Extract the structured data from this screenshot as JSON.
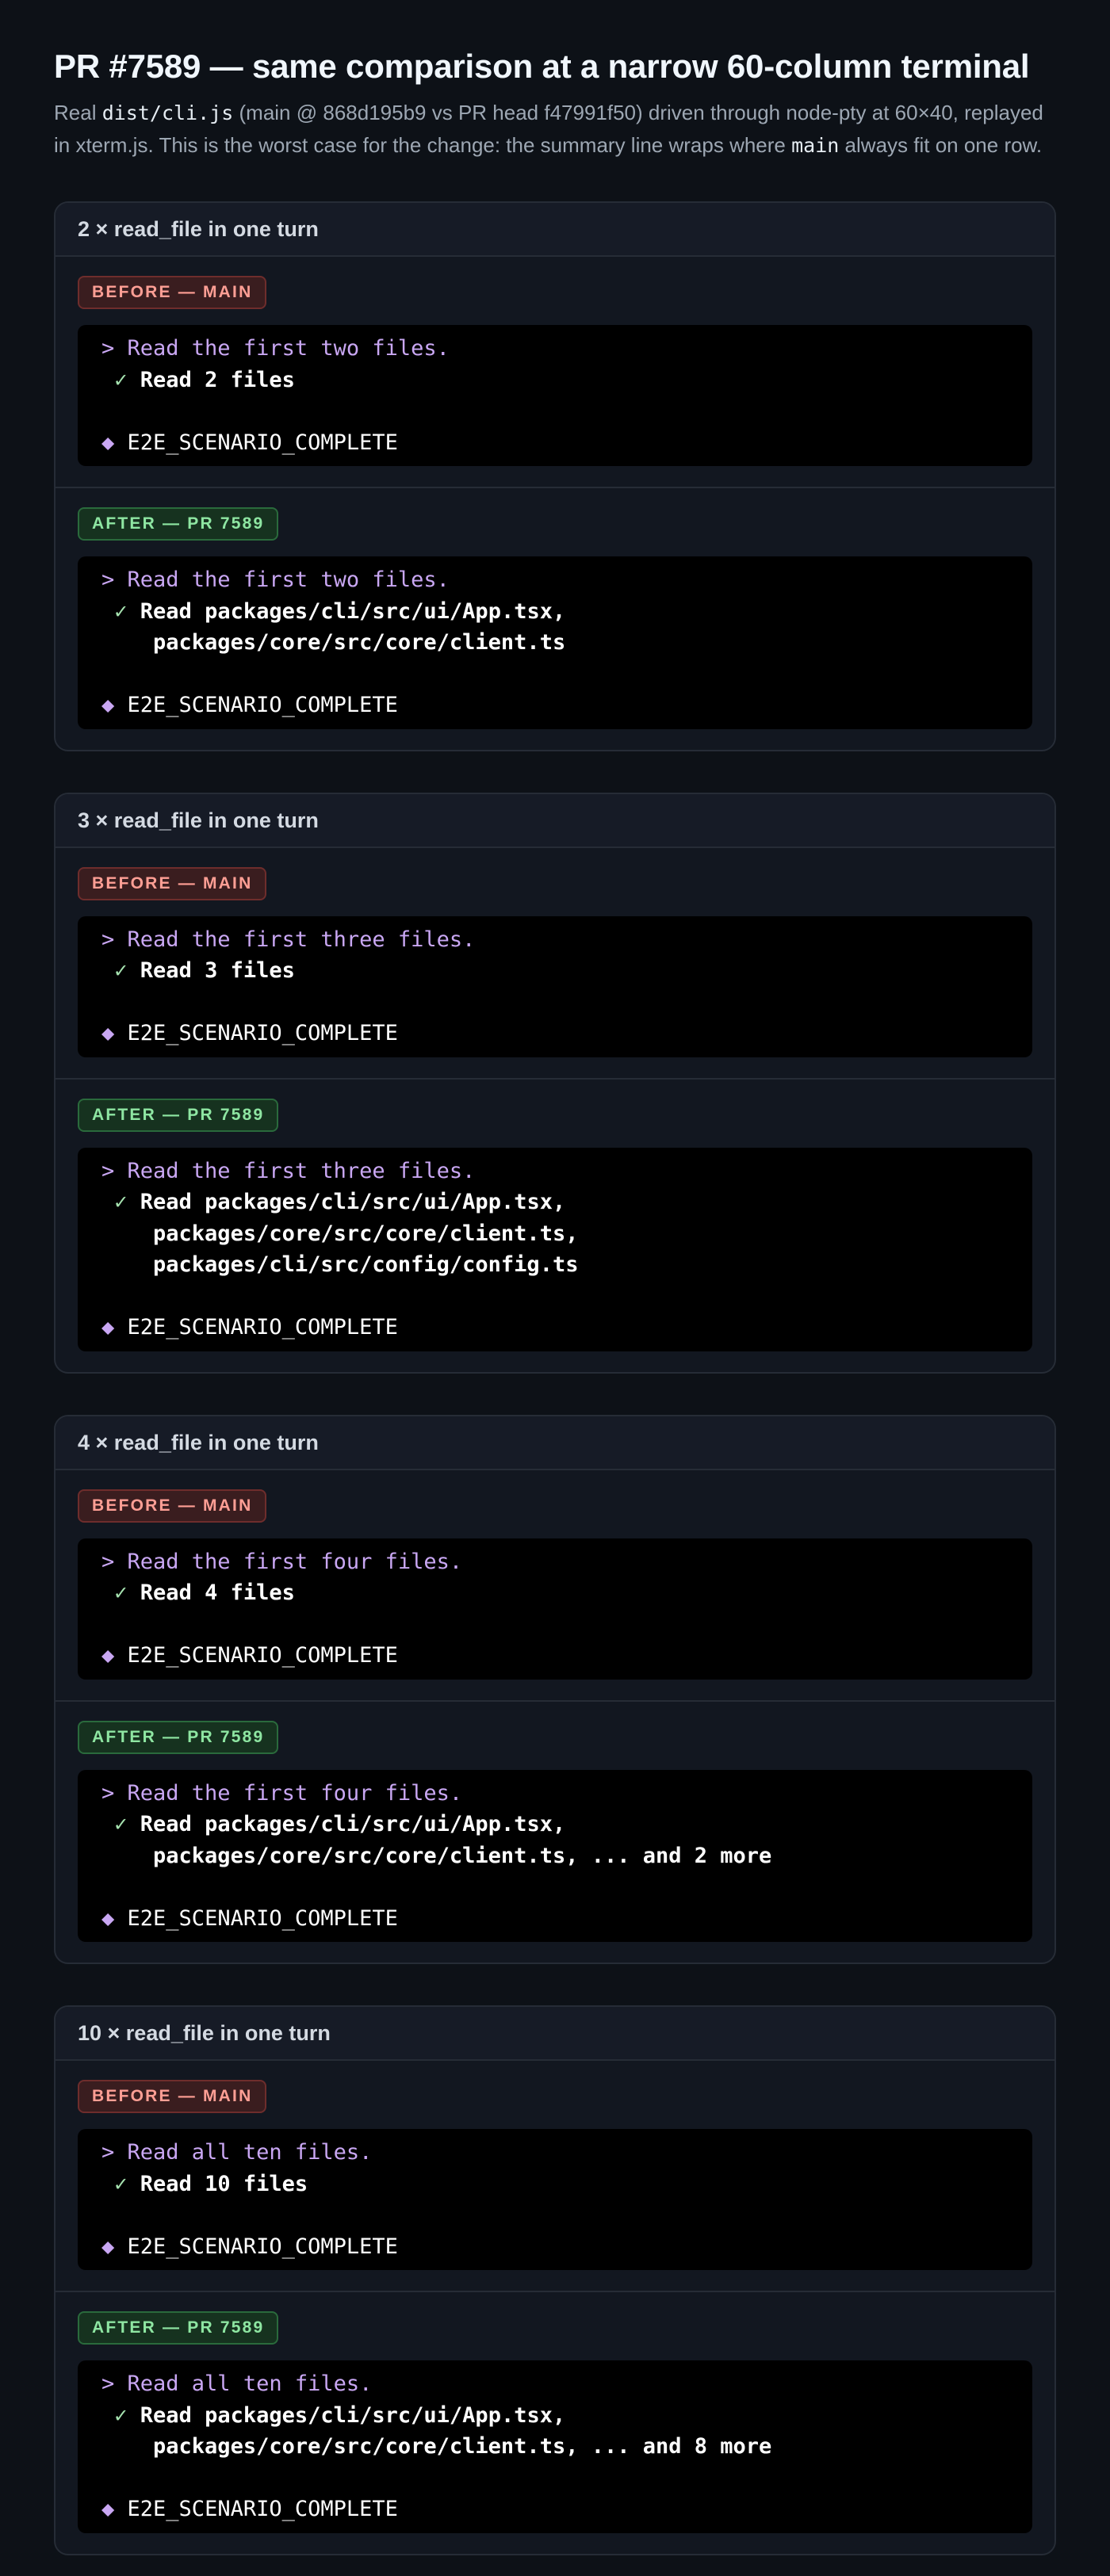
{
  "page": {
    "title": "PR #7589 — same comparison at a narrow 60-column terminal",
    "subtitle": {
      "t1": "Real ",
      "code1": "dist/cli.js",
      "t2": " (main @ 868d195b9 vs PR head f47991f50) driven through node-pty at 60×40, replayed in xterm.js. This is the worst case for the change: the summary line wraps where ",
      "code2": "main",
      "t3": " always fit on one row."
    }
  },
  "labels": {
    "before": "BEFORE — MAIN",
    "after": "AFTER — PR 7589",
    "prompt_prefix": "> ",
    "check": "✓",
    "diamond": "◆",
    "complete": "E2E_SCENARIO_COMPLETE"
  },
  "scenarios": [
    {
      "heading": "2 × read_file in one turn",
      "before": {
        "prompt": "Read the first two files.",
        "summary": [
          "Read 2 files"
        ]
      },
      "after": {
        "prompt": "Read the first two files.",
        "summary": [
          "Read packages/cli/src/ui/App.tsx,",
          "packages/core/src/core/client.ts"
        ]
      }
    },
    {
      "heading": "3 × read_file in one turn",
      "before": {
        "prompt": "Read the first three files.",
        "summary": [
          "Read 3 files"
        ]
      },
      "after": {
        "prompt": "Read the first three files.",
        "summary": [
          "Read packages/cli/src/ui/App.tsx,",
          "packages/core/src/core/client.ts,",
          "packages/cli/src/config/config.ts"
        ]
      }
    },
    {
      "heading": "4 × read_file in one turn",
      "before": {
        "prompt": "Read the first four files.",
        "summary": [
          "Read 4 files"
        ]
      },
      "after": {
        "prompt": "Read the first four files.",
        "summary": [
          "Read packages/cli/src/ui/App.tsx,",
          "packages/core/src/core/client.ts, ... and 2 more"
        ]
      }
    },
    {
      "heading": "10 × read_file in one turn",
      "before": {
        "prompt": "Read all ten files.",
        "summary": [
          "Read 10 files"
        ]
      },
      "after": {
        "prompt": "Read all ten files.",
        "summary": [
          "Read packages/cli/src/ui/App.tsx,",
          "packages/core/src/core/client.ts, ... and 8 more"
        ]
      }
    }
  ]
}
